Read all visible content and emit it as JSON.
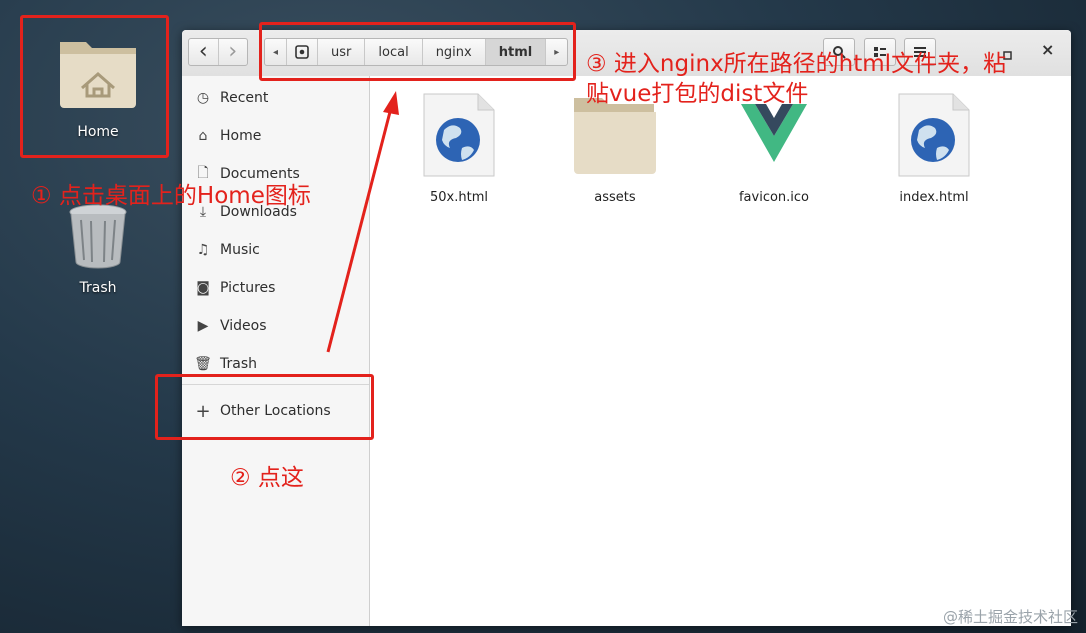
{
  "desktop": {
    "icons": [
      {
        "label": "Home",
        "icon": "home-folder-icon"
      },
      {
        "label": "Trash",
        "icon": "trash-bin-icon"
      }
    ]
  },
  "window": {
    "nav": {
      "back": "‹",
      "forward": "›"
    },
    "path": {
      "left_arrow": "◂",
      "right_arrow": "▸",
      "crumbs": [
        "usr",
        "local",
        "nginx",
        "html"
      ],
      "active": "html"
    },
    "controls": {
      "search": "search-icon",
      "view": "view-options-icon",
      "menu": "menu-icon",
      "restore": "restore-icon",
      "close": "×"
    },
    "sidebar": [
      {
        "label": "Recent",
        "icon": "clock-icon"
      },
      {
        "label": "Home",
        "icon": "home-icon"
      },
      {
        "label": "Documents",
        "icon": "document-icon"
      },
      {
        "label": "Downloads",
        "icon": "download-icon"
      },
      {
        "label": "Music",
        "icon": "music-icon"
      },
      {
        "label": "Pictures",
        "icon": "camera-icon"
      },
      {
        "label": "Videos",
        "icon": "video-icon"
      },
      {
        "label": "Trash",
        "icon": "trash-icon"
      },
      {
        "label": "Other Locations",
        "icon": "plus-icon"
      }
    ],
    "files": [
      {
        "name": "50x.html",
        "icon": "html-globe-icon"
      },
      {
        "name": "assets",
        "icon": "folder-icon"
      },
      {
        "name": "favicon.ico",
        "icon": "vue-logo-icon"
      },
      {
        "name": "index.html",
        "icon": "html-globe-icon"
      }
    ]
  },
  "annotations": {
    "step1": "① 点击桌面上的Home图标",
    "step2": "② 点这",
    "step3_line1": "③ 进入nginx所在路径的html文件夹，粘",
    "step3_line2": "贴vue打包的dist文件",
    "color": "#e3221c"
  },
  "watermark": "@稀土掘金技术社区"
}
